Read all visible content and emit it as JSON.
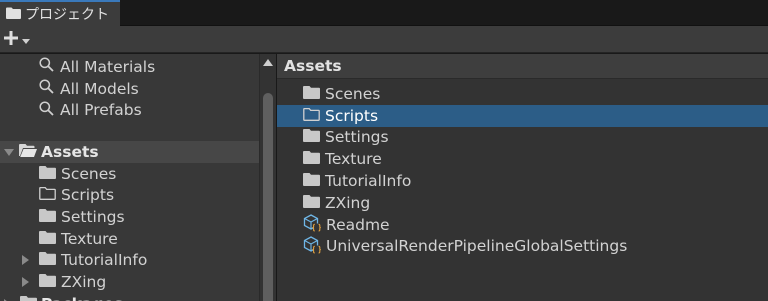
{
  "tab": {
    "icon": "folder-icon",
    "label": "プロジェクト"
  },
  "toolbar": {
    "add_icon": "plus-icon",
    "dropdown_icon": "caret-down-icon"
  },
  "left_tree": {
    "favorites": [
      {
        "label": "All Materials",
        "icon": "search-icon"
      },
      {
        "label": "All Models",
        "icon": "search-icon"
      },
      {
        "label": "All Prefabs",
        "icon": "search-icon"
      }
    ],
    "assets_label": "Assets",
    "assets_children": [
      {
        "label": "Scenes",
        "icon": "folder-icon",
        "expandable": false
      },
      {
        "label": "Scripts",
        "icon": "folder-outline-icon",
        "expandable": false
      },
      {
        "label": "Settings",
        "icon": "folder-icon",
        "expandable": false
      },
      {
        "label": "Texture",
        "icon": "folder-icon",
        "expandable": false
      },
      {
        "label": "TutorialInfo",
        "icon": "folder-icon",
        "expandable": true
      },
      {
        "label": "ZXing",
        "icon": "folder-icon",
        "expandable": true
      }
    ],
    "packages_label": "Packages"
  },
  "right_panel": {
    "header": "Assets",
    "items": [
      {
        "label": "Scenes",
        "icon": "folder-icon",
        "selected": false
      },
      {
        "label": "Scripts",
        "icon": "folder-outline-icon",
        "selected": true
      },
      {
        "label": "Settings",
        "icon": "folder-icon",
        "selected": false
      },
      {
        "label": "Texture",
        "icon": "folder-icon",
        "selected": false
      },
      {
        "label": "TutorialInfo",
        "icon": "folder-icon",
        "selected": false
      },
      {
        "label": "ZXing",
        "icon": "folder-icon",
        "selected": false
      },
      {
        "label": "Readme",
        "icon": "scriptable-object-icon",
        "selected": false
      },
      {
        "label": "UniversalRenderPipelineGlobalSettings",
        "icon": "scriptable-object-icon",
        "selected": false
      }
    ]
  },
  "colors": {
    "selection": "#2c5d87",
    "accent": "#3a79bb",
    "panel": "#383838"
  }
}
